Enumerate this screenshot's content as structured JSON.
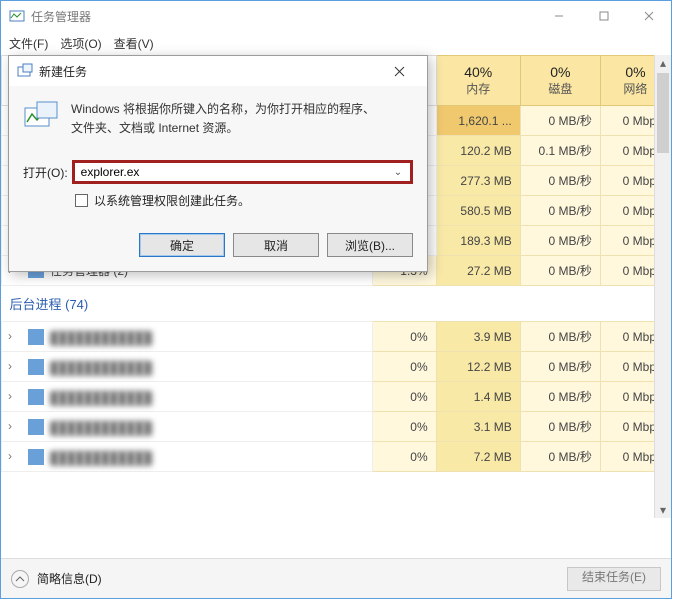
{
  "window": {
    "title": "任务管理器"
  },
  "menu": {
    "file": "文件(F)",
    "options": "选项(O)",
    "view": "查看(V)"
  },
  "columns": {
    "cpu_pct": "40%",
    "cpu_lbl": "内存",
    "disk_pct": "0%",
    "disk_lbl": "磁盘",
    "net_pct": "0%",
    "net_lbl": "网络"
  },
  "rows": [
    {
      "name": "",
      "cpu": "",
      "mem": "1,620.1 ...",
      "disk": "0 MB/秒",
      "net": "0 Mbps",
      "dark": true
    },
    {
      "name": "",
      "cpu": "",
      "mem": "120.2 MB",
      "disk": "0.1 MB/秒",
      "net": "0 Mbps"
    },
    {
      "name": "",
      "cpu": "",
      "mem": "277.3 MB",
      "disk": "0 MB/秒",
      "net": "0 Mbps"
    },
    {
      "name": "",
      "cpu": "",
      "mem": "580.5 MB",
      "disk": "0 MB/秒",
      "net": "0 Mbps"
    },
    {
      "name": "",
      "cpu": "",
      "mem": "189.3 MB",
      "disk": "0 MB/秒",
      "net": "0 Mbps"
    },
    {
      "name": "任务管理器 (2)",
      "cpu": "1.3%",
      "mem": "27.2 MB",
      "disk": "0 MB/秒",
      "net": "0 Mbps",
      "icon": true,
      "expand": true
    }
  ],
  "section": "后台进程 (74)",
  "bg_rows": [
    {
      "cpu": "0%",
      "mem": "3.9 MB",
      "disk": "0 MB/秒",
      "net": "0 Mbps"
    },
    {
      "cpu": "0%",
      "mem": "12.2 MB",
      "disk": "0 MB/秒",
      "net": "0 Mbps"
    },
    {
      "cpu": "0%",
      "mem": "1.4 MB",
      "disk": "0 MB/秒",
      "net": "0 Mbps"
    },
    {
      "cpu": "0%",
      "mem": "3.1 MB",
      "disk": "0 MB/秒",
      "net": "0 Mbps"
    },
    {
      "cpu": "0%",
      "mem": "7.2 MB",
      "disk": "0 MB/秒",
      "net": "0 Mbps"
    }
  ],
  "footer": {
    "brief": "简略信息(D)",
    "endtask": "结束任务(E)"
  },
  "dialog": {
    "title": "新建任务",
    "message1": "Windows 将根据你所键入的名称，为你打开相应的程序、",
    "message2": "文件夹、文档或 Internet 资源。",
    "open_label": "打开(O):",
    "input_value": "explorer.ex",
    "checkbox_label": "以系统管理权限创建此任务。",
    "ok": "确定",
    "cancel": "取消",
    "browse": "浏览(B)..."
  }
}
